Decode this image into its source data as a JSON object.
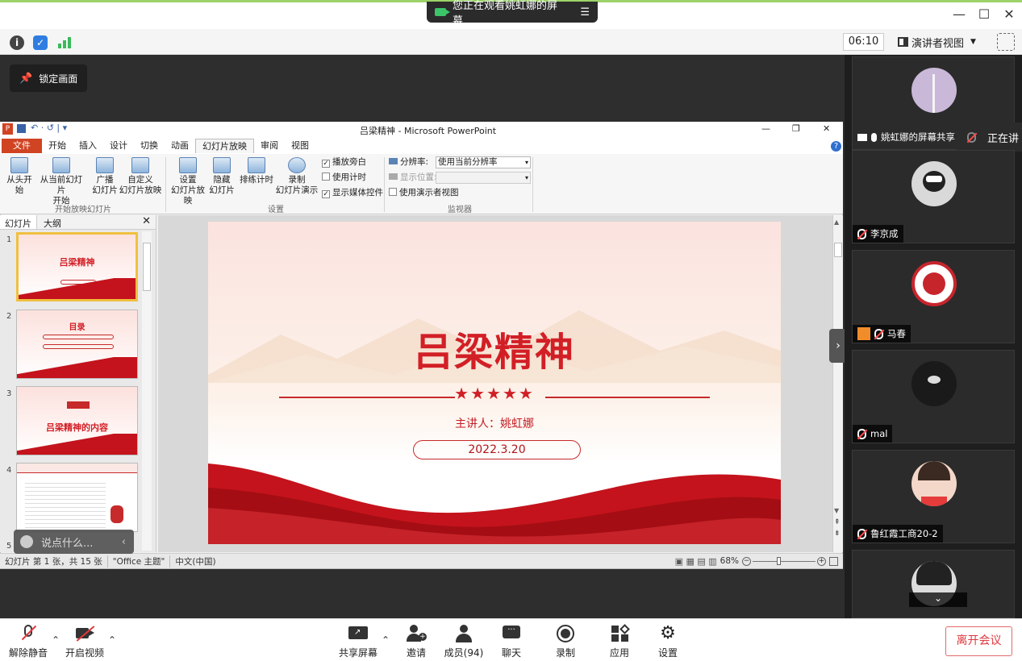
{
  "window": {
    "share_banner": "您正在观看姚虹娜的屏幕",
    "minimize": "—",
    "maximize": "☐",
    "close": "✕"
  },
  "infobar": {
    "timer": "06:10",
    "view_mode": "演讲者视图"
  },
  "stage": {
    "lock_label": "锁定画面",
    "chat_placeholder": "说点什么..."
  },
  "ppt": {
    "title": "吕梁精神 - Microsoft PowerPoint",
    "tabs": [
      "文件",
      "开始",
      "插入",
      "设计",
      "切换",
      "动画",
      "幻灯片放映",
      "审阅",
      "视图"
    ],
    "ribbon": {
      "from_start": "从头开始",
      "from_current_1": "从当前幻灯片",
      "from_current_2": "开始",
      "broadcast_1": "广播",
      "broadcast_2": "幻灯片",
      "custom_1": "自定义",
      "custom_2": "幻灯片放映",
      "group1": "开始放映幻灯片",
      "setup_1": "设置",
      "setup_2": "幻灯片放映",
      "hide_1": "隐藏",
      "hide_2": "幻灯片",
      "rehearse": "排练计时",
      "record_1": "录制",
      "record_2": "幻灯片演示",
      "play_narration": "播放旁白",
      "use_timings": "使用计时",
      "show_media": "显示媒体控件",
      "group2": "设置",
      "resolution_label": "分辨率:",
      "resolution_value": "使用当前分辨率",
      "show_on": "显示位置:",
      "presenter_view": "使用演示者视图",
      "group3": "监视器"
    },
    "thumb_tabs": [
      "幻灯片",
      "大纲"
    ],
    "thumbnails": [
      {
        "num": "1",
        "title": "吕梁精神"
      },
      {
        "num": "2",
        "title": "目录"
      },
      {
        "num": "3",
        "title": "吕梁精神的内容"
      },
      {
        "num": "4",
        "title": ""
      },
      {
        "num": "5",
        "title": ""
      }
    ],
    "slide": {
      "title": "吕梁精神",
      "stars": "★★★★★",
      "presenter": "主讲人：姚虹娜",
      "date": "2022.3.20"
    },
    "status": {
      "slide_info": "幻灯片 第 1 张，共 15 张",
      "theme": "\"Office 主题\"",
      "language": "中文(中国)",
      "zoom": "68%"
    }
  },
  "participants": [
    {
      "name": "姚虹娜的屏幕共享",
      "color": "#c9b8d8"
    },
    {
      "name": "李京成",
      "color": "#d9d9d9"
    },
    {
      "name": "马春",
      "color": "#c7252c"
    },
    {
      "name": "mal",
      "color": "#1a1a1a"
    },
    {
      "name": "鲁红霞工商20-2",
      "color": "#f3d7c8"
    },
    {
      "name": "",
      "color": "#dcdcdc"
    }
  ],
  "speaking": "正在讲",
  "toolbar": {
    "unmute": "解除静音",
    "video": "开启视频",
    "share": "共享屏幕",
    "invite": "邀请",
    "members": "成员(94)",
    "chat": "聊天",
    "record": "录制",
    "apps": "应用",
    "settings": "设置",
    "leave": "离开会议"
  }
}
